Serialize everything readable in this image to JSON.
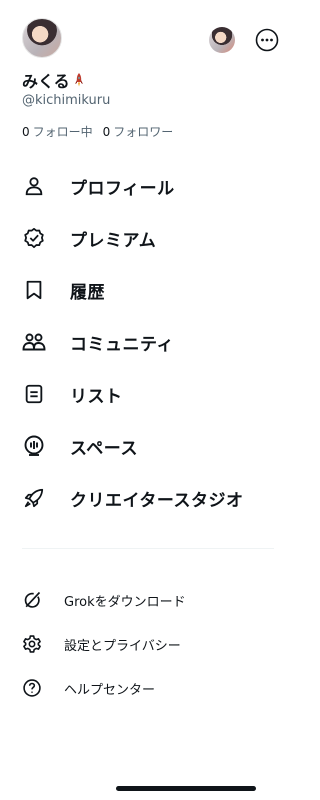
{
  "profile": {
    "display_name": "みくる",
    "handle": "@kichimikuru",
    "following_count": "0",
    "following_label": "フォロー中",
    "followers_count": "0",
    "followers_label": "フォロワー"
  },
  "nav": [
    {
      "label": "プロフィール",
      "icon": "person-icon"
    },
    {
      "label": "プレミアム",
      "icon": "verified-badge-icon"
    },
    {
      "label": "履歴",
      "icon": "bookmark-icon"
    },
    {
      "label": "コミュニティ",
      "icon": "people-icon"
    },
    {
      "label": "リスト",
      "icon": "list-icon"
    },
    {
      "label": "スペース",
      "icon": "spaces-icon"
    },
    {
      "label": "クリエイタースタジオ",
      "icon": "rocket-icon"
    }
  ],
  "secondary": [
    {
      "label": "Grokをダウンロード",
      "icon": "grok-icon"
    },
    {
      "label": "設定とプライバシー",
      "icon": "gear-icon"
    },
    {
      "label": "ヘルプセンター",
      "icon": "help-icon"
    }
  ],
  "colors": {
    "text": "#0f1419",
    "secondary_text": "#536471",
    "background": "#ffffff",
    "divider": "#eff3f4"
  }
}
